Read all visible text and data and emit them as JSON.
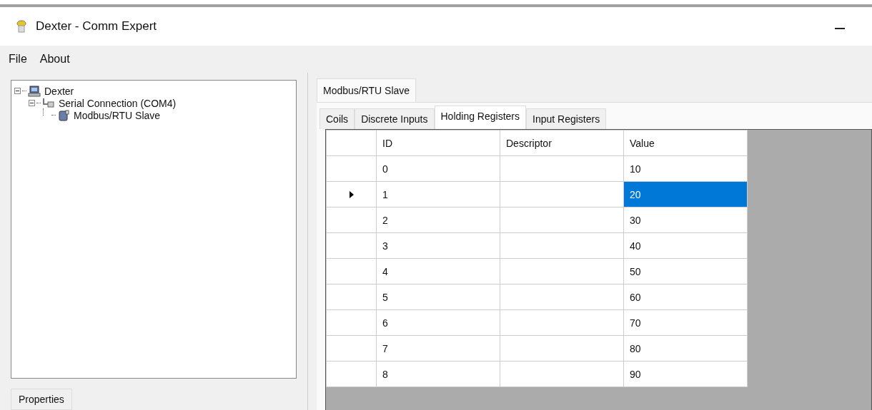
{
  "window": {
    "title": "Dexter - Comm Expert"
  },
  "menu": [
    "File",
    "About"
  ],
  "tree": [
    {
      "label": "Dexter",
      "kind": "computer",
      "expanded": true,
      "children": [
        {
          "label": "Serial Connection (COM4)",
          "kind": "serial",
          "expanded": true,
          "children": [
            {
              "label": "Modbus/RTU Slave",
              "kind": "device"
            }
          ]
        }
      ]
    }
  ],
  "bottom_tabs": [
    {
      "label": "Properties"
    }
  ],
  "document_tabs": [
    {
      "label": "Modbus/RTU Slave",
      "selected": true
    }
  ],
  "tabs": [
    {
      "label": "Coils",
      "selected": false
    },
    {
      "label": "Discrete Inputs",
      "selected": false
    },
    {
      "label": "Holding Registers",
      "selected": true
    },
    {
      "label": "Input Registers",
      "selected": false
    }
  ],
  "table": {
    "columns": [
      "ID",
      "Descriptor",
      "Value"
    ],
    "rows": [
      {
        "cells": [
          "0",
          "",
          "10"
        ],
        "selected": false
      },
      {
        "cells": [
          "1",
          "",
          "20"
        ],
        "selected": true
      },
      {
        "cells": [
          "2",
          "",
          "30"
        ],
        "selected": false
      },
      {
        "cells": [
          "3",
          "",
          "40"
        ],
        "selected": false
      },
      {
        "cells": [
          "4",
          "",
          "50"
        ],
        "selected": false
      },
      {
        "cells": [
          "5",
          "",
          "60"
        ],
        "selected": false
      },
      {
        "cells": [
          "6",
          "",
          "70"
        ],
        "selected": false
      },
      {
        "cells": [
          "7",
          "",
          "80"
        ],
        "selected": false
      },
      {
        "cells": [
          "8",
          "",
          "90"
        ],
        "selected": false
      }
    ]
  }
}
